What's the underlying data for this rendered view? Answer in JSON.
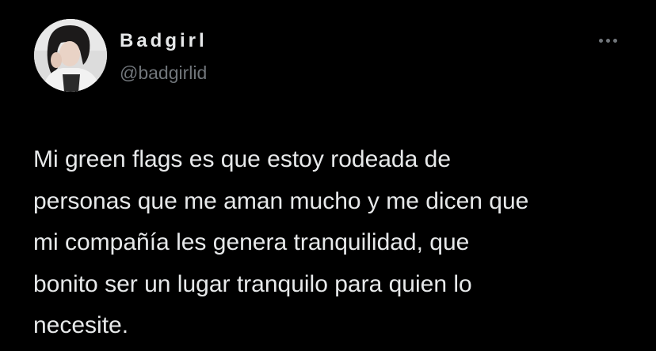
{
  "tweet": {
    "display_name": "Badgirl",
    "handle": "@badgirlid",
    "more_icon": "more-horizontal-icon",
    "text": "Mi green flags es que estoy rodeada de\npersonas que me aman mucho y me dicen que\nmi compañía les genera tranquilidad, que\nbonito ser un lugar tranquilo para quien lo\nnecesite."
  },
  "colors": {
    "background": "#000000",
    "primary_text": "#e7e9ea",
    "secondary_text": "#71767b"
  }
}
